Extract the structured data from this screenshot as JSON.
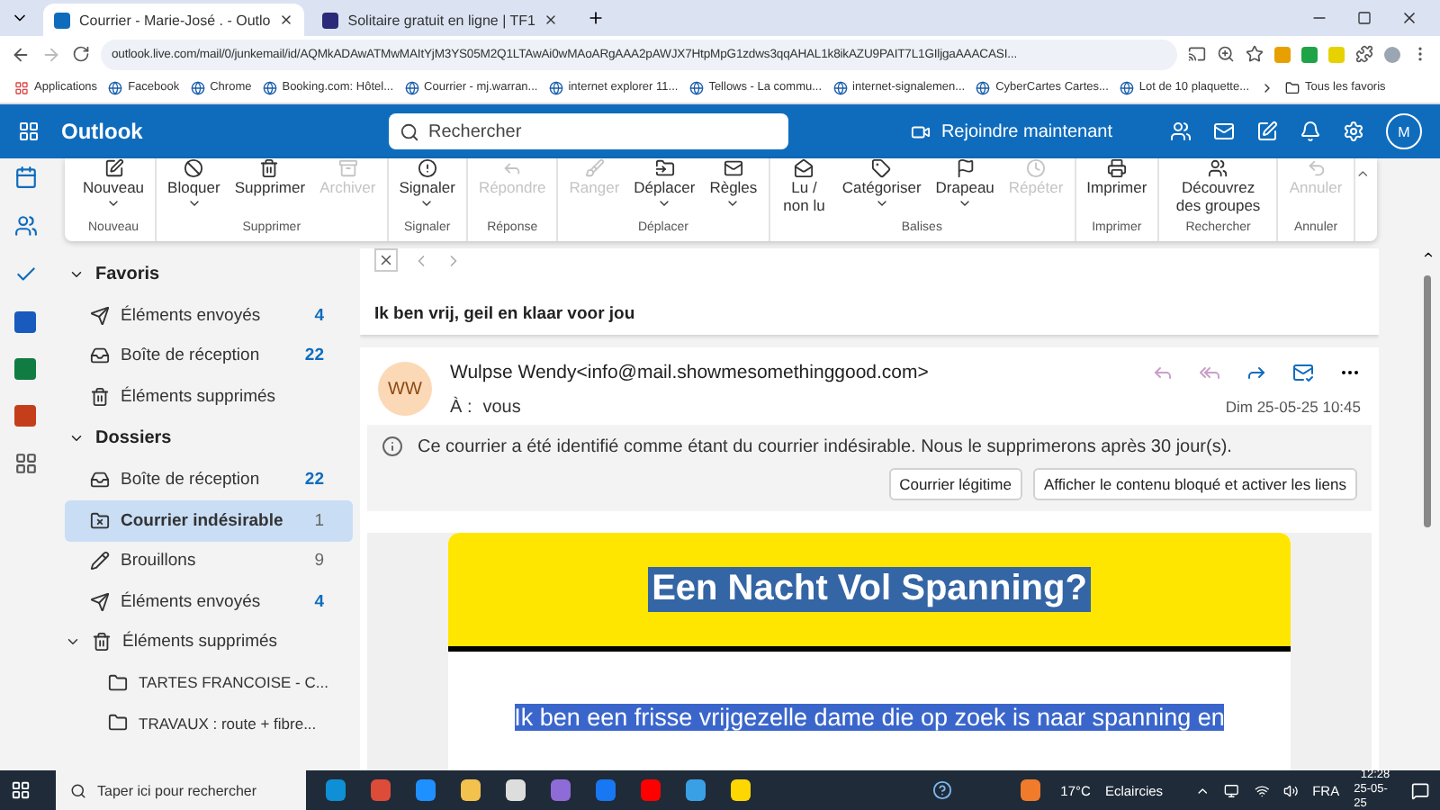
{
  "browser": {
    "tabs": [
      {
        "title": "Courrier - Marie-José . - Outlo",
        "selected": true
      },
      {
        "title": "Solitaire gratuit en ligne | TF1",
        "selected": false
      }
    ],
    "url": "outlook.live.com/mail/0/junkemail/id/AQMkADAwATMwMAItYjM3YS05M2Q1LTAwAi0wMAoARgAAA2pAWJX7HtpMpG1zdws3qqAHAL1k8ikAZU9PAIT7L1GIljgaAAACASI...",
    "apps_label": "Applications",
    "bookmarks": [
      "Facebook",
      "Chrome",
      "Booking.com: Hôtel...",
      "Courrier - mj.warran...",
      "internet explorer 11...",
      "Tellows - La commu...",
      "internet-signalemen...",
      "CyberCartes Cartes...",
      "Lot de 10 plaquette..."
    ],
    "all_bookmarks": "Tous les favoris"
  },
  "header": {
    "app": "Outlook",
    "search_placeholder": "Rechercher",
    "join": "Rejoindre maintenant",
    "avatar": "M"
  },
  "ribbon": [
    {
      "label": "Nouveau",
      "items": [
        {
          "label": "Nouveau",
          "kind": "new",
          "disabled": false,
          "dropdown": true
        }
      ]
    },
    {
      "label": "Supprimer",
      "items": [
        {
          "label": "Bloquer",
          "kind": "block",
          "disabled": false,
          "dropdown": true
        },
        {
          "label": "Supprimer",
          "kind": "delete",
          "disabled": false,
          "dropdown": false
        },
        {
          "label": "Archiver",
          "kind": "archive",
          "disabled": true,
          "dropdown": false
        }
      ]
    },
    {
      "label": "Signaler",
      "items": [
        {
          "label": "Signaler",
          "kind": "report",
          "disabled": false,
          "dropdown": true
        }
      ]
    },
    {
      "label": "Réponse",
      "items": [
        {
          "label": "Répondre",
          "kind": "reply",
          "disabled": true,
          "dropdown": false
        }
      ]
    },
    {
      "label": "Déplacer",
      "items": [
        {
          "label": "Ranger",
          "kind": "sweep",
          "disabled": true,
          "dropdown": false
        },
        {
          "label": "Déplacer",
          "kind": "move",
          "disabled": false,
          "dropdown": true
        },
        {
          "label": "Règles",
          "kind": "rules",
          "disabled": false,
          "dropdown": true
        }
      ]
    },
    {
      "label": "Balises",
      "items": [
        {
          "label": "Lu / non lu",
          "kind": "read",
          "disabled": false,
          "dropdown": false
        },
        {
          "label": "Catégoriser",
          "kind": "tag",
          "disabled": false,
          "dropdown": true
        },
        {
          "label": "Drapeau",
          "kind": "flag",
          "disabled": false,
          "dropdown": true
        },
        {
          "label": "Répéter",
          "kind": "snooze",
          "disabled": true,
          "dropdown": false
        }
      ]
    },
    {
      "label": "Imprimer",
      "items": [
        {
          "label": "Imprimer",
          "kind": "print",
          "disabled": false,
          "dropdown": false
        }
      ]
    },
    {
      "label": "Rechercher",
      "items": [
        {
          "label": "Découvrez des groupes",
          "kind": "groups",
          "disabled": false,
          "dropdown": false
        }
      ]
    },
    {
      "label": "Annuler",
      "items": [
        {
          "label": "Annuler",
          "kind": "undo",
          "disabled": true,
          "dropdown": false
        }
      ]
    }
  ],
  "sidebar": [
    {
      "title": "Favoris",
      "expanded": true,
      "items": [
        {
          "label": "Éléments envoyés",
          "kind": "sent",
          "count": "4",
          "unread": true,
          "selected": false
        },
        {
          "label": "Boîte de réception",
          "kind": "inbox",
          "count": "22",
          "unread": true,
          "selected": false
        },
        {
          "label": "Éléments supprimés",
          "kind": "trash",
          "selected": false
        }
      ]
    },
    {
      "title": "Dossiers",
      "expanded": true,
      "items": [
        {
          "label": "Boîte de réception",
          "kind": "inbox",
          "count": "22",
          "unread": true,
          "selected": false
        },
        {
          "label": "Courrier indésirable",
          "kind": "junk",
          "count": "1",
          "unread": false,
          "selected": true
        },
        {
          "label": "Brouillons",
          "kind": "draft",
          "count": "9",
          "unread": false,
          "selected": false
        },
        {
          "label": "Éléments envoyés",
          "kind": "sent",
          "count": "4",
          "unread": true,
          "selected": false
        },
        {
          "label": "Éléments supprimés",
          "kind": "trash",
          "selected": false,
          "expanded": true,
          "children": [
            {
              "label": "TARTES FRANCOISE - C...",
              "kind": "folder",
              "selected": false
            },
            {
              "label": "TRAVAUX : route + fibre...",
              "kind": "folder",
              "selected": false
            }
          ]
        }
      ]
    }
  ],
  "message": {
    "subject": "Ik ben vrij, geil en klaar voor jou",
    "initials": "WW",
    "sender": "Wulpse Wendy<info@mail.showmesomethinggood.com>",
    "to_label": "À :",
    "to": "vous",
    "date": "Dim 25-05-25 10:45",
    "notice": "Ce courrier a été identifié comme étant du courrier indésirable. Nous le supprimerons après 30 jour(s).",
    "buttons": [
      "Courrier légitime",
      "Afficher le contenu bloqué et activer les liens"
    ],
    "heading": "Een Nacht Vol Spanning?",
    "body": "Ik ben een frisse vrijgezelle dame die op zoek is naar spanning en"
  },
  "taskbar": {
    "search_placeholder": "Taper ici pour rechercher",
    "temperature": "17°C",
    "weather": "Eclaircies",
    "language": "FRA",
    "time": "12:28",
    "date": "25-05-25"
  }
}
